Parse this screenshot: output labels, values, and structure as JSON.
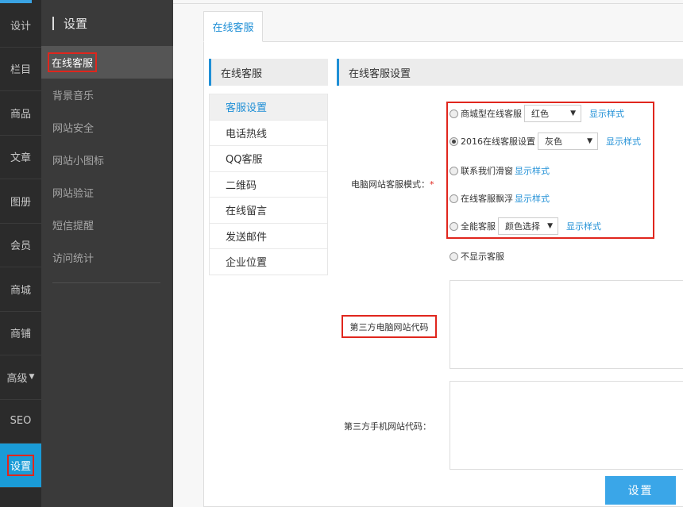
{
  "nav": {
    "items": [
      {
        "label": "设计"
      },
      {
        "label": "栏目"
      },
      {
        "label": "商品"
      },
      {
        "label": "文章"
      },
      {
        "label": "图册"
      },
      {
        "label": "会员"
      },
      {
        "label": "商城"
      },
      {
        "label": "商铺"
      },
      {
        "label": "高级"
      },
      {
        "label": "SEO"
      },
      {
        "label": "设置"
      }
    ],
    "active_index": 10,
    "accent": "#1a9bd7",
    "highlight": "#e0261d"
  },
  "sidebar": {
    "title": "设置",
    "items": [
      {
        "label": "在线客服"
      },
      {
        "label": "背景音乐"
      },
      {
        "label": "网站安全"
      },
      {
        "label": "网站小图标"
      },
      {
        "label": "网站验证"
      },
      {
        "label": "短信提醒"
      },
      {
        "label": "访问统计"
      }
    ]
  },
  "tab": {
    "label": "在线客服"
  },
  "submenu": {
    "title": "在线客服",
    "items": [
      {
        "label": "客服设置"
      },
      {
        "label": "电话热线"
      },
      {
        "label": "QQ客服"
      },
      {
        "label": "二维码"
      },
      {
        "label": "在线留言"
      },
      {
        "label": "发送邮件"
      },
      {
        "label": "企业位置"
      }
    ]
  },
  "settings": {
    "title": "在线客服设置",
    "pc_mode_label": "电脑网站客服模式：",
    "required_mark": "*",
    "options": [
      {
        "label": "商城型在线客服",
        "select": "红色",
        "link": "显示样式",
        "checked": false
      },
      {
        "label": "2016在线客服设置",
        "select": "灰色",
        "link": "显示样式",
        "checked": true
      },
      {
        "label": "联系我们滑窗",
        "link": "显示样式",
        "checked": false
      },
      {
        "label": "在线客服飘浮",
        "link": "显示样式",
        "checked": false
      },
      {
        "label": "全能客服",
        "select": "颜色选择",
        "link": "显示样式",
        "checked": false
      },
      {
        "label": "不显示客服",
        "checked": false
      }
    ],
    "third_pc_label": "第三方电脑网站代码",
    "third_mobile_label": "第三方手机网站代码：",
    "submit_label": "设置"
  }
}
